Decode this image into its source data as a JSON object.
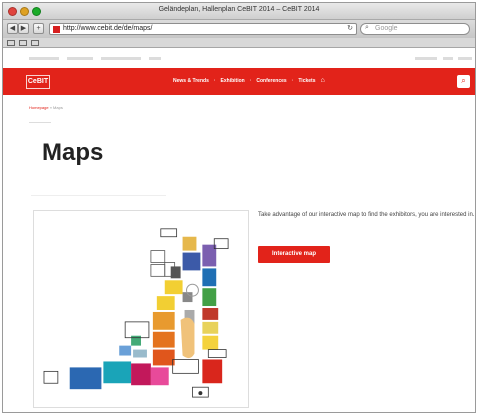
{
  "window": {
    "title": "Geländeplan, Hallenplan CeBIT 2014 – CeBIT 2014"
  },
  "browser": {
    "url": "http://www.cebit.de/de/maps/",
    "search_placeholder": "Google",
    "back_icon": "arrow-left-icon",
    "forward_icon": "arrow-right-icon",
    "add_icon": "plus-icon",
    "reload_icon": "reload-icon"
  },
  "site": {
    "logo_text": "CeBIT",
    "nav": {
      "items": [
        "News & Trends",
        "Exhibition",
        "Conferences",
        "Tickets"
      ]
    },
    "breadcrumb": {
      "home": "Homepage",
      "current": "Maps"
    },
    "page_title": "Maps",
    "intro_text": "Take advantage of our interactive map to find the exhibitors, you are interested in.",
    "cta_label": "Interactive map",
    "accent_color": "#e2231a"
  }
}
